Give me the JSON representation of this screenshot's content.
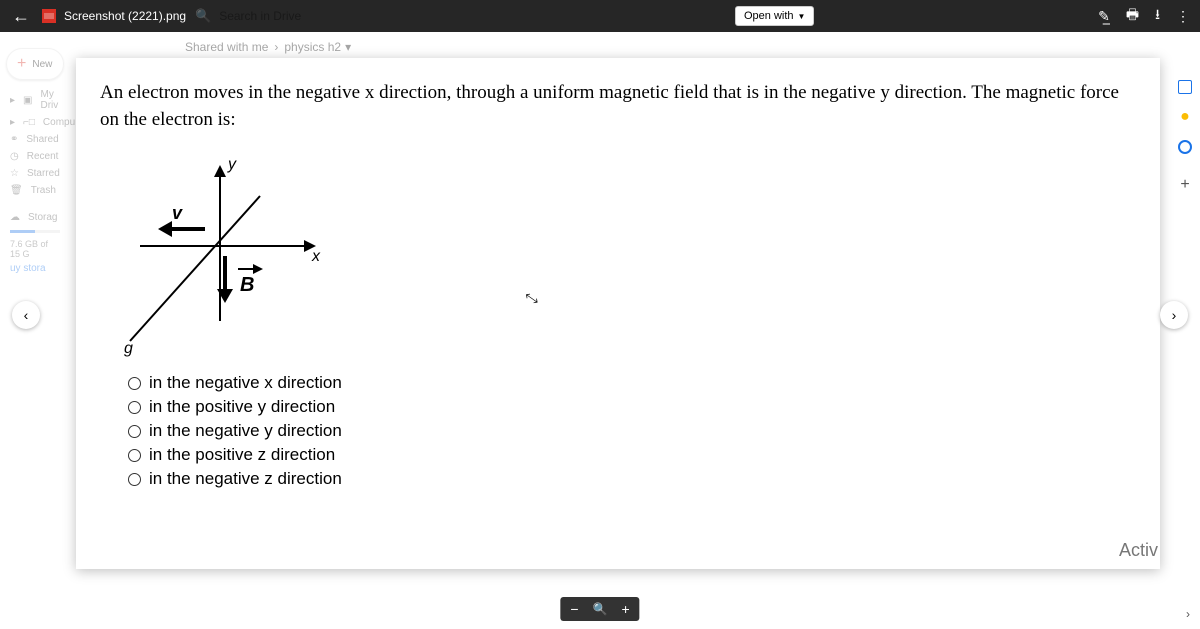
{
  "topbar": {
    "filename": "Screenshot (2221).png",
    "search_placeholder": "Search in Drive",
    "openwith": "Open with"
  },
  "breadcrumb": {
    "a": "Shared with me",
    "b": "physics h2"
  },
  "sidebar": {
    "new": "New",
    "items": [
      "My Driv",
      "Compu",
      "Shared",
      "Recent",
      "Starred",
      "Trash",
      "Storag"
    ],
    "storage": "7.6 GB of 15 G",
    "buy": "uy stora"
  },
  "content": {
    "question": "An electron moves in the negative x direction, through a uniform magnetic field that is in the negative y direction.  The magnetic force on the electron is:",
    "labels": {
      "y": "y",
      "x": "x",
      "v": "v",
      "b": "B",
      "g": "g"
    },
    "options": [
      "in the negative x direction",
      "in the positive y direction",
      "in the negative y direction",
      "in the positive z direction",
      "in the negative z direction"
    ],
    "watermark": "Activ"
  }
}
